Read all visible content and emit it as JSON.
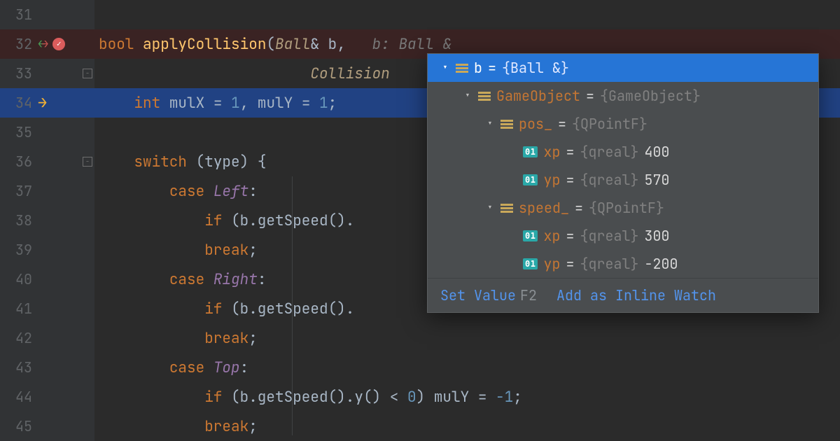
{
  "editor": {
    "lines": {
      "31": {
        "num": "31"
      },
      "32": {
        "num": "32",
        "kw_bool": "bool",
        "fn": "applyCollision",
        "lparen": "(",
        "type1": "Ball",
        "amp": "& ",
        "param1": "b",
        "comma": ", ",
        "hint": "  b: Ball &"
      },
      "33": {
        "num": "33",
        "indent": "                        ",
        "type2": "Collision"
      },
      "34": {
        "num": "34",
        "indent": "    ",
        "kw_int": "int",
        "var1": " mulX ",
        "eq1": "= ",
        "val1": "1",
        "comma": ", ",
        "var2": "mulY ",
        "eq2": "= ",
        "val2": "1",
        "semi": ";"
      },
      "35": {
        "num": "35"
      },
      "36": {
        "num": "36",
        "indent": "    ",
        "kw": "switch",
        "rest": " (type) {"
      },
      "37": {
        "num": "37",
        "indent": "        ",
        "kw": "case ",
        "enum": "Left",
        "colon": ":"
      },
      "38": {
        "num": "38",
        "indent": "            ",
        "kw": "if",
        "rest": " (b.getSpeed()."
      },
      "39": {
        "num": "39",
        "indent": "            ",
        "kw": "break",
        "semi": ";"
      },
      "40": {
        "num": "40",
        "indent": "        ",
        "kw": "case ",
        "enum": "Right",
        "colon": ":"
      },
      "41": {
        "num": "41",
        "indent": "            ",
        "kw": "if",
        "rest": " (b.getSpeed()."
      },
      "42": {
        "num": "42",
        "indent": "            ",
        "kw": "break",
        "semi": ";"
      },
      "43": {
        "num": "43",
        "indent": "        ",
        "kw": "case ",
        "enum": "Top",
        "colon": ":"
      },
      "44": {
        "num": "44",
        "indent": "            ",
        "kw": "if",
        "rest_a": " (b.getSpeed().y() < ",
        "zero": "0",
        "rest_b": ") mulY = ",
        "neg1": "-1",
        "semi": ";"
      },
      "45": {
        "num": "45",
        "indent": "            ",
        "kw": "break",
        "semi": ";"
      }
    }
  },
  "popup": {
    "rows": [
      {
        "indent": 0,
        "expanded": true,
        "icon": "struct",
        "key": "b",
        "eq": " = ",
        "type": "{Ball &}",
        "val": "",
        "selected": true
      },
      {
        "indent": 1,
        "expanded": true,
        "icon": "struct",
        "key": "GameObject",
        "eq": " = ",
        "type": "{GameObject}",
        "val": ""
      },
      {
        "indent": 2,
        "expanded": true,
        "icon": "struct",
        "key": "pos_",
        "eq": " = ",
        "type": "{QPointF}",
        "val": ""
      },
      {
        "indent": 3,
        "icon": "prim",
        "key": "xp",
        "eq": " = ",
        "type": "{qreal}",
        "val": " 400"
      },
      {
        "indent": 3,
        "icon": "prim",
        "key": "yp",
        "eq": " = ",
        "type": "{qreal}",
        "val": " 570"
      },
      {
        "indent": 2,
        "expanded": true,
        "icon": "struct",
        "key": "speed_",
        "eq": " = ",
        "type": "{QPointF}",
        "val": ""
      },
      {
        "indent": 3,
        "icon": "prim",
        "key": "xp",
        "eq": " = ",
        "type": "{qreal}",
        "val": " 300"
      },
      {
        "indent": 3,
        "icon": "prim",
        "key": "yp",
        "eq": " = ",
        "type": "{qreal}",
        "val": " -200"
      }
    ],
    "footer": {
      "set_value": "Set Value",
      "set_value_key": "F2",
      "add_watch": "Add as Inline Watch"
    },
    "prim_badge": "01"
  }
}
